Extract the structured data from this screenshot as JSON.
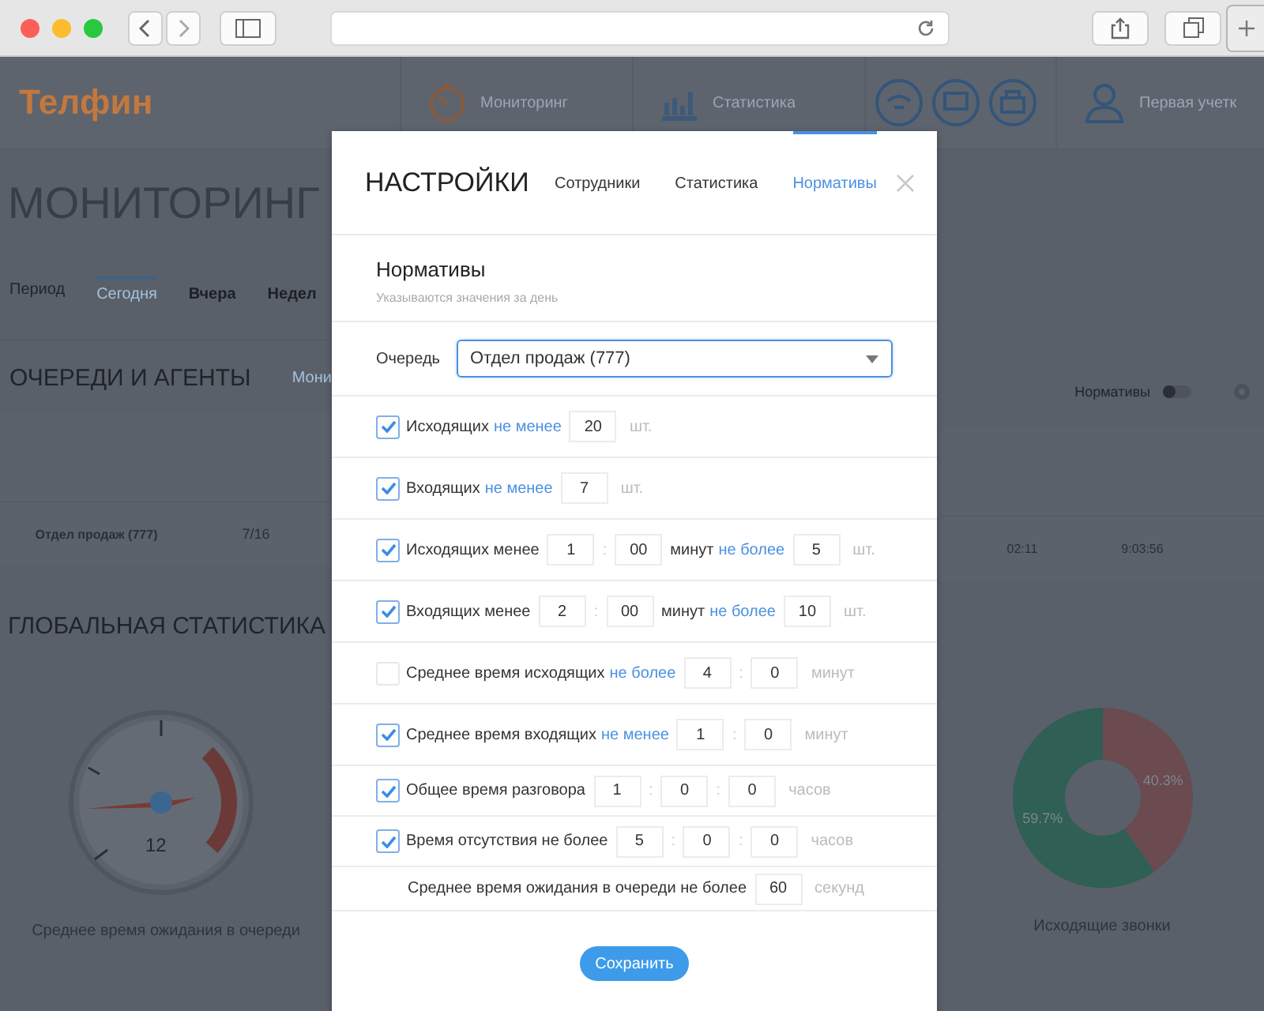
{
  "app": {
    "logo": "Телфин",
    "nav": [
      {
        "label": "Мониторинг",
        "kind": "clock"
      },
      {
        "label": "Статистика",
        "kind": "chart"
      }
    ],
    "user": "Первая учетк",
    "title": "МОНИТОРИНГ",
    "period": [
      {
        "label": "Период",
        "kind": "label"
      },
      {
        "label": "Сегодня",
        "selected": true,
        "kind": "tab"
      },
      {
        "label": "Вчера",
        "selected": false,
        "kind": "tab"
      },
      {
        "label": "Недел",
        "selected": false,
        "kind": "tab"
      }
    ],
    "queues": {
      "title": "ОЧЕРЕДИ И АГЕНТЫ",
      "tab": "Мони",
      "norms_label": "Нормативы",
      "norms_on": false,
      "rows": [
        {
          "name": "Отдел продаж (777)",
          "ratio": "7/16",
          "col_a": "02:11",
          "col_b": "9:03:56"
        }
      ]
    },
    "global": {
      "title": "ГЛОБАЛЬНАЯ СТАТИСТИКА",
      "gauge_value": "12",
      "gauge_caption": "Среднее время ожидания в очереди",
      "donut_caption": "Исходящие звонки",
      "chart_data": {
        "type": "donut",
        "values": [
          40.3,
          59.7
        ],
        "value_labels": [
          "40.3%",
          "59.7%"
        ]
      }
    }
  },
  "modal": {
    "title": "НАСТРОЙКИ",
    "tabs": [
      {
        "label": "Сотрудники",
        "selected": false
      },
      {
        "label": "Статистика",
        "selected": false
      },
      {
        "label": "Нормативы",
        "selected": true
      }
    ],
    "section": "Нормативы",
    "hint": "Указываются значения за день",
    "queue_label": "Очередь",
    "queue_value": "Отдел продаж (777)",
    "rows": [
      {
        "kind": "check",
        "checked": true,
        "parts": [
          {
            "kind": "text",
            "text": "Исходящих"
          },
          {
            "kind": "link",
            "text": "не менее"
          },
          {
            "kind": "input",
            "value": "20"
          },
          {
            "kind": "unit",
            "text": "шт."
          }
        ]
      },
      {
        "kind": "check",
        "checked": true,
        "parts": [
          {
            "kind": "text",
            "text": "Входящих"
          },
          {
            "kind": "link",
            "text": "не менее"
          },
          {
            "kind": "input",
            "value": "7"
          },
          {
            "kind": "unit",
            "text": "шт."
          }
        ]
      },
      {
        "kind": "check",
        "checked": true,
        "parts": [
          {
            "kind": "text",
            "text": "Исходящих менее"
          },
          {
            "kind": "input",
            "value": "1"
          },
          {
            "kind": "sep",
            "text": ":"
          },
          {
            "kind": "input",
            "value": "00"
          },
          {
            "kind": "text",
            "text": "минут"
          },
          {
            "kind": "link",
            "text": "не более"
          },
          {
            "kind": "input",
            "value": "5"
          },
          {
            "kind": "unit",
            "text": "шт."
          }
        ]
      },
      {
        "kind": "check",
        "checked": true,
        "parts": [
          {
            "kind": "text",
            "text": "Входящих менее"
          },
          {
            "kind": "input",
            "value": "2"
          },
          {
            "kind": "sep",
            "text": ":"
          },
          {
            "kind": "input",
            "value": "00"
          },
          {
            "kind": "text",
            "text": "минут"
          },
          {
            "kind": "link",
            "text": "не более"
          },
          {
            "kind": "input",
            "value": "10"
          },
          {
            "kind": "unit",
            "text": "шт."
          }
        ]
      },
      {
        "kind": "check",
        "checked": false,
        "parts": [
          {
            "kind": "text",
            "text": "Среднее время исходящих"
          },
          {
            "kind": "link",
            "text": "не более"
          },
          {
            "kind": "input",
            "value": "4"
          },
          {
            "kind": "sep",
            "text": ":"
          },
          {
            "kind": "input",
            "value": "0"
          },
          {
            "kind": "unit",
            "text": "минут"
          }
        ]
      },
      {
        "kind": "check",
        "checked": true,
        "parts": [
          {
            "kind": "text",
            "text": "Среднее время входящих"
          },
          {
            "kind": "link",
            "text": "не менее"
          },
          {
            "kind": "input",
            "value": "1"
          },
          {
            "kind": "sep",
            "text": ":"
          },
          {
            "kind": "input",
            "value": "0"
          },
          {
            "kind": "unit",
            "text": "минут"
          }
        ]
      },
      {
        "kind": "check",
        "checked": true,
        "parts": [
          {
            "kind": "text",
            "text": "Общее время разговора"
          },
          {
            "kind": "input",
            "value": "1"
          },
          {
            "kind": "sep",
            "text": ":"
          },
          {
            "kind": "input",
            "value": "0"
          },
          {
            "kind": "sep",
            "text": ":"
          },
          {
            "kind": "input",
            "value": "0"
          },
          {
            "kind": "unit",
            "text": "часов"
          }
        ]
      },
      {
        "kind": "check",
        "checked": true,
        "parts": [
          {
            "kind": "text",
            "text": "Время отсутствия не более"
          },
          {
            "kind": "input",
            "value": "5"
          },
          {
            "kind": "sep",
            "text": ":"
          },
          {
            "kind": "input",
            "value": "0"
          },
          {
            "kind": "sep",
            "text": ":"
          },
          {
            "kind": "input",
            "value": "0"
          },
          {
            "kind": "unit",
            "text": "часов"
          }
        ]
      },
      {
        "kind": "plain",
        "parts": [
          {
            "kind": "text",
            "text": "Среднее время ожидания в очереди не более"
          },
          {
            "kind": "input",
            "value": "60"
          },
          {
            "kind": "unit",
            "text": "секунд"
          }
        ]
      }
    ],
    "save": "Сохранить"
  }
}
